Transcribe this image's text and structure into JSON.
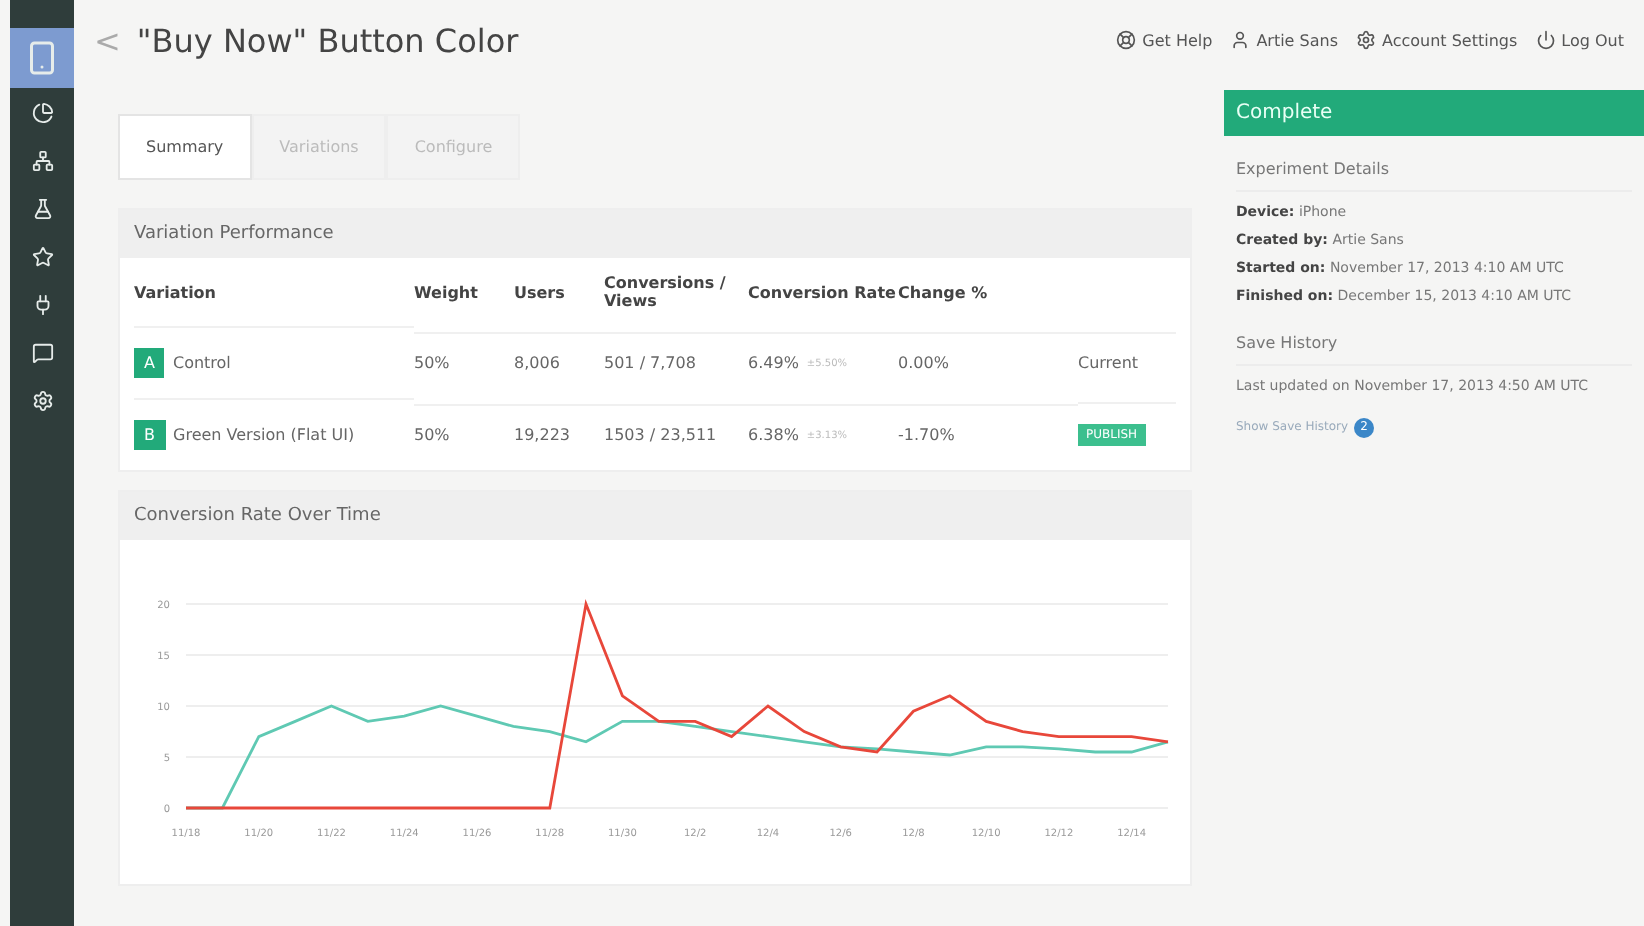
{
  "sidebar": {
    "items": [
      {
        "kind": "device",
        "selected": true
      },
      {
        "kind": "pie",
        "selected": false
      },
      {
        "kind": "network",
        "selected": false
      },
      {
        "kind": "flask",
        "selected": false
      },
      {
        "kind": "star",
        "selected": false
      },
      {
        "kind": "plug",
        "selected": false
      },
      {
        "kind": "chat",
        "selected": false
      },
      {
        "kind": "gear",
        "selected": false
      }
    ]
  },
  "header": {
    "back": "<",
    "title": "\"Buy Now\" Button Color",
    "links": [
      {
        "kind": "help",
        "label": "Get Help"
      },
      {
        "kind": "user",
        "label": "Artie Sans"
      },
      {
        "kind": "settings",
        "label": "Account Settings"
      },
      {
        "kind": "logout",
        "label": "Log Out"
      }
    ]
  },
  "tabs": [
    {
      "label": "Summary",
      "selected": true
    },
    {
      "label": "Variations",
      "selected": false
    },
    {
      "label": "Configure",
      "selected": false
    }
  ],
  "performance": {
    "title": "Variation Performance",
    "columns": [
      "Variation",
      "Weight",
      "Users",
      "Conversions / Views",
      "Conversion Rate",
      "Change %"
    ],
    "rows": [
      {
        "badge": "A",
        "name": "Control",
        "weight": "50%",
        "users": "8,006",
        "conversions": "501 / 7,708",
        "rate": "6.49%",
        "interval": "±5.50%",
        "change": "0.00%",
        "status": {
          "kind": "text",
          "label": "Current"
        }
      },
      {
        "badge": "B",
        "name": "Green Version (Flat UI)",
        "weight": "50%",
        "users": "19,223",
        "conversions": "1503 / 23,511",
        "rate": "6.38%",
        "interval": "±3.13%",
        "change": "-1.70%",
        "status": {
          "kind": "button",
          "label": "PUBLISH"
        }
      }
    ]
  },
  "chart": {
    "title": "Conversion Rate Over Time",
    "chart_data": {
      "type": "line",
      "categories": [
        "11/18",
        null,
        "11/20",
        null,
        "11/22",
        null,
        "11/24",
        null,
        "11/26",
        null,
        "11/28",
        null,
        "11/30",
        null,
        "12/2",
        null,
        "12/4",
        null,
        "12/6",
        null,
        "12/8",
        null,
        "12/10",
        null,
        "12/12",
        null,
        "12/14",
        null
      ],
      "series": [
        {
          "color": "#5fc9b3",
          "values": [
            0,
            0,
            7,
            8.5,
            10,
            8.5,
            9,
            10,
            9,
            8,
            7.5,
            6.5,
            8.5,
            8.5,
            8,
            7.5,
            7,
            6.5,
            6,
            5.8,
            5.5,
            5.2,
            6,
            6,
            5.8,
            5.5,
            5.5,
            6.5
          ]
        },
        {
          "color": "#e8473a",
          "values": [
            0,
            0,
            0,
            0,
            0,
            0,
            0,
            0,
            0,
            0,
            0,
            20,
            11,
            8.5,
            8.5,
            7,
            10,
            7.5,
            6,
            5.5,
            9.5,
            11,
            8.5,
            7.5,
            7,
            7,
            7,
            6.5
          ]
        }
      ],
      "ylim": [
        0,
        20
      ],
      "grid": true,
      "yticks": [
        0,
        5,
        10,
        15,
        20
      ]
    }
  },
  "status": {
    "label": "Complete"
  },
  "details": {
    "title": "Experiment Details",
    "fields": [
      {
        "label": "Device:",
        "value": "iPhone"
      },
      {
        "label": "Created by:",
        "value": "Artie Sans"
      },
      {
        "label": "Started on:",
        "value": "November 17, 2013 4:10 AM UTC"
      },
      {
        "label": "Finished on:",
        "value": "December 15, 2013 4:10 AM UTC"
      }
    ]
  },
  "history": {
    "title": "Save History",
    "updated": "Last updated on November 17, 2013 4:50 AM UTC",
    "link": "Show Save History",
    "count": "2"
  }
}
